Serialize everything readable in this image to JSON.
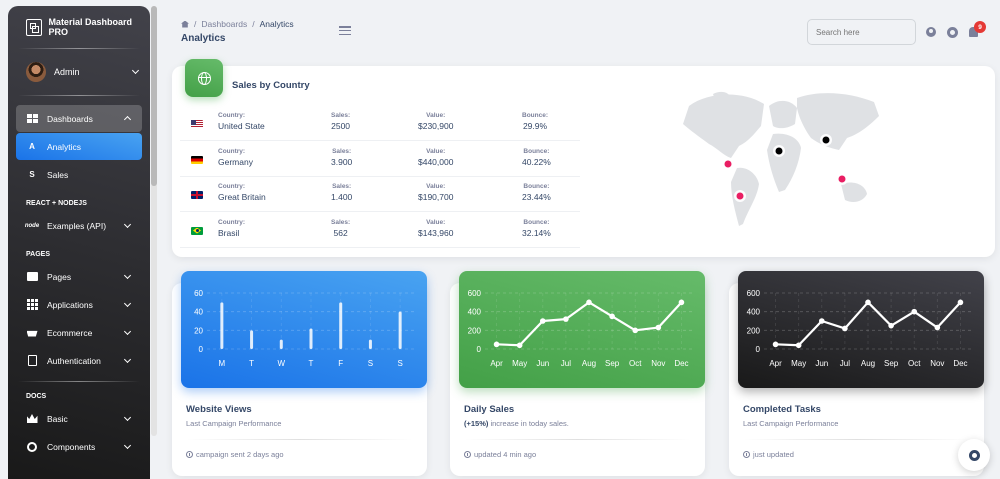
{
  "sidebar": {
    "brand": "Material Dashboard PRO",
    "user": "Admin",
    "dashboards": "Dashboards",
    "analytics_letter": "A",
    "analytics": "Analytics",
    "sales_letter": "S",
    "sales": "Sales",
    "section_react": "REACT + NODEJS",
    "examples": "Examples (API)",
    "section_pages": "PAGES",
    "pages": "Pages",
    "applications": "Applications",
    "ecommerce": "Ecommerce",
    "authentication": "Authentication",
    "section_docs": "DOCS",
    "basic": "Basic",
    "components": "Components"
  },
  "header": {
    "crumb1": "Dashboards",
    "crumb_sep": "/",
    "crumb2": "Analytics",
    "title": "Analytics",
    "search_placeholder": "Search here",
    "notifications": "9"
  },
  "sales_by_country": {
    "title": "Sales by Country",
    "labels": {
      "country": "Country:",
      "sales": "Sales:",
      "value": "Value:",
      "bounce": "Bounce:"
    },
    "rows": [
      {
        "flag": "us",
        "country": "United State",
        "sales": "2500",
        "value": "$230,900",
        "bounce": "29.9%"
      },
      {
        "flag": "de",
        "country": "Germany",
        "sales": "3.900",
        "value": "$440,000",
        "bounce": "40.22%"
      },
      {
        "flag": "gb",
        "country": "Great Britain",
        "sales": "1.400",
        "value": "$190,700",
        "bounce": "23.44%"
      },
      {
        "flag": "br",
        "country": "Brasil",
        "sales": "562",
        "value": "$143,960",
        "bounce": "32.14%"
      }
    ]
  },
  "cards": {
    "website_views": {
      "title": "Website Views",
      "subtitle": "Last Campaign Performance",
      "footer": "campaign sent 2 days ago"
    },
    "daily_sales": {
      "title": "Daily Sales",
      "subtitle_bold": "(+15%)",
      "subtitle": " increase in today sales.",
      "footer": "updated 4 min ago"
    },
    "completed_tasks": {
      "title": "Completed Tasks",
      "subtitle": "Last Campaign Performance",
      "footer": "just updated"
    }
  },
  "chart_data": [
    {
      "type": "bar",
      "title": "Website Views",
      "categories": [
        "M",
        "T",
        "W",
        "T",
        "F",
        "S",
        "S"
      ],
      "values": [
        50,
        20,
        10,
        22,
        50,
        10,
        40
      ],
      "yticks": [
        "0",
        "20",
        "40",
        "60"
      ],
      "ylim": [
        0,
        60
      ]
    },
    {
      "type": "line",
      "title": "Daily Sales",
      "categories": [
        "Apr",
        "May",
        "Jun",
        "Jul",
        "Aug",
        "Sep",
        "Oct",
        "Nov",
        "Dec"
      ],
      "values": [
        50,
        40,
        300,
        320,
        500,
        350,
        200,
        230,
        500
      ],
      "yticks": [
        "0",
        "200",
        "400",
        "600"
      ],
      "ylim": [
        0,
        600
      ]
    },
    {
      "type": "line",
      "title": "Completed Tasks",
      "categories": [
        "Apr",
        "May",
        "Jun",
        "Jul",
        "Aug",
        "Sep",
        "Oct",
        "Nov",
        "Dec"
      ],
      "values": [
        50,
        40,
        300,
        220,
        500,
        250,
        400,
        230,
        500
      ],
      "yticks": [
        "0",
        "200",
        "400",
        "600"
      ],
      "ylim": [
        0,
        600
      ]
    }
  ],
  "map_markers": [
    {
      "name": "north-america",
      "color": "#e91e63"
    },
    {
      "name": "south-america",
      "color": "#e91e63"
    },
    {
      "name": "europe",
      "color": "#000000"
    },
    {
      "name": "asia-north",
      "color": "#000000"
    },
    {
      "name": "asia-south",
      "color": "#e91e63"
    }
  ]
}
